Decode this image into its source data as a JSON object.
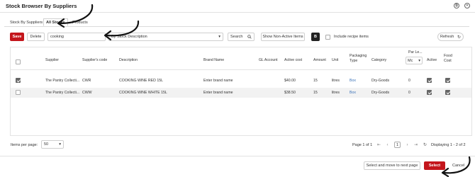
{
  "window": {
    "title": "Stock Browser By Suppliers"
  },
  "tabs": [
    {
      "label": "Stock By Suppliers"
    },
    {
      "label": "All Stocks"
    },
    {
      "label": "Products"
    }
  ],
  "toolbar": {
    "save_label": "Save",
    "delete_label": "Delete",
    "search_value": "cooking",
    "filter_select": "By Stock Description",
    "search_label": "Search",
    "show_nonactive_label": "Show Non-Active Items",
    "include_recipe_label": "Include recipe items",
    "refresh_label": "Refresh"
  },
  "table": {
    "headers": {
      "supplier": "Supplier",
      "suppliers_code": "Supplier's code",
      "description": "Description",
      "brand_name": "Brand Name",
      "gl_account": "GL Account",
      "active_cost": "Active cost",
      "amount": "Amount",
      "unit": "Unit",
      "packaging_type": "Packaging Type",
      "category": "Category",
      "par_level": "Par Le...",
      "par_select": "Mc",
      "active": "Active",
      "food_cost": "Food Cost"
    },
    "rows": [
      {
        "selected": true,
        "supplier": "The Pantry Collecti...",
        "code": "CWR",
        "description": "COOKING WINE RED 15L",
        "brand_name": "Enter brand name",
        "active_cost": "$40.00",
        "amount": "15",
        "unit": "litres",
        "packaging_type": "Box",
        "category": "Dry-Goods",
        "par_level": "0",
        "active": true,
        "food_cost": true
      },
      {
        "selected": false,
        "supplier": "The Pantry Collecti...",
        "code": "CWW",
        "description": "COOKING WINE WHITE 15L",
        "brand_name": "Enter brand name",
        "active_cost": "$38.50",
        "amount": "15",
        "unit": "litres",
        "packaging_type": "Box",
        "category": "Dry-Goods",
        "par_level": "0",
        "active": true,
        "food_cost": true
      }
    ]
  },
  "pager": {
    "items_per_page_label": "Items per page:",
    "items_per_page_value": "50",
    "page_info": "Page 1 of 1",
    "current_page": "1",
    "display_info": "Displaying 1 - 2 of 2"
  },
  "footer": {
    "select_next_label": "Select and move to next page",
    "select_label": "Select",
    "cancel_label": "Cancel"
  },
  "colors": {
    "accent": "#c4161c",
    "link": "#3a72b8"
  }
}
